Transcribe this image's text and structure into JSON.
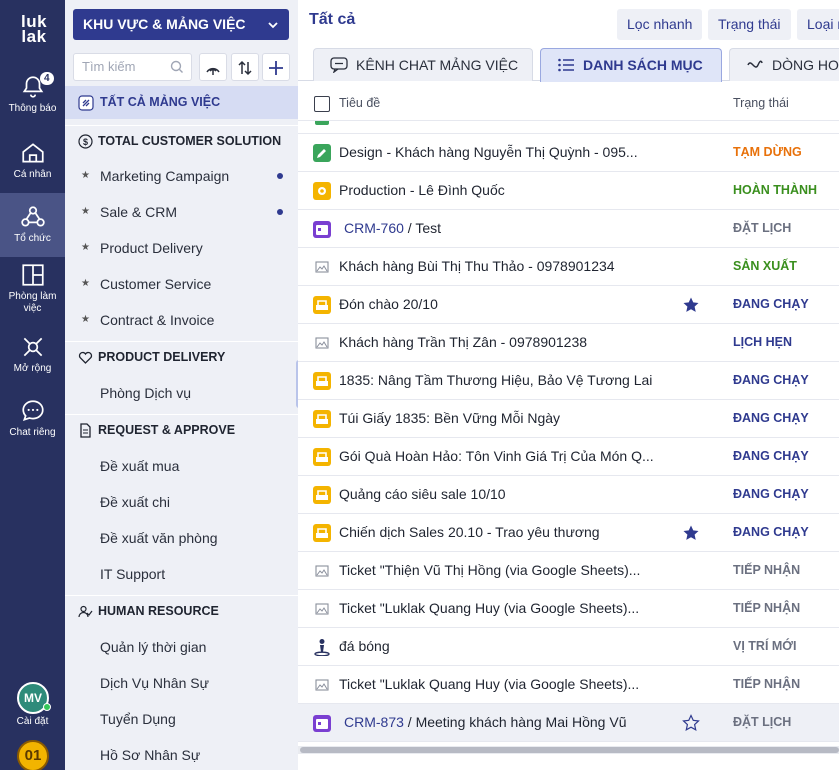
{
  "rail": {
    "logo": "luk\nlak",
    "items": [
      {
        "label": "Thông báo",
        "icon": "bell-icon",
        "badge": "4"
      },
      {
        "label": "Cá nhân",
        "icon": "home-icon"
      },
      {
        "label": "Tổ chức",
        "icon": "organization-icon"
      },
      {
        "label": "Phòng làm\nviệc",
        "icon": "workspace-icon"
      },
      {
        "label": "Mở rộng",
        "icon": "extension-icon"
      },
      {
        "label": "Chat riêng",
        "icon": "chat-icon"
      }
    ],
    "avatar_initials": "MV",
    "settings_label": "Cài đặt",
    "org_badge": "01"
  },
  "sidebar": {
    "workspace_select": "KHU VỰC & MẢNG VIỆC",
    "search_placeholder": "Tìm kiếm",
    "all_workspaces": "TẤT CẢ MẢNG VIỆC",
    "groups": [
      {
        "title": "TOTAL CUSTOMER SOLUTION",
        "icon": "dollar-icon",
        "items": [
          {
            "label": "Marketing Campaign",
            "starred": true,
            "unread": true
          },
          {
            "label": "Sale & CRM",
            "starred": true,
            "unread": true
          },
          {
            "label": "Product Delivery",
            "starred": true
          },
          {
            "label": "Customer Service",
            "starred": true
          },
          {
            "label": "Contract & Invoice",
            "starred": true
          }
        ]
      },
      {
        "title": "PRODUCT DELIVERY",
        "icon": "heart-icon",
        "items": [
          {
            "label": "Phòng Dịch vụ"
          }
        ]
      },
      {
        "title": "REQUEST & APPROVE",
        "icon": "file-icon",
        "items": [
          {
            "label": "Đề xuất mua"
          },
          {
            "label": "Đề xuất chi"
          },
          {
            "label": "Đề xuất văn phòng"
          },
          {
            "label": "IT Support"
          }
        ]
      },
      {
        "title": "HUMAN RESOURCE",
        "icon": "people-icon",
        "items": [
          {
            "label": "Quản lý thời gian"
          },
          {
            "label": "Dịch Vụ Nhân Sự"
          },
          {
            "label": "Tuyển Dụng"
          },
          {
            "label": "Hồ Sơ Nhân Sự"
          }
        ]
      }
    ]
  },
  "main": {
    "title": "Tất cả",
    "header_buttons": [
      "Lọc nhanh",
      "Trạng thái",
      "Loại m"
    ],
    "tabs": [
      {
        "label": "KÊNH CHAT MẢNG VIỆC",
        "icon": "chat-bubble-icon"
      },
      {
        "label": "DANH SÁCH MỤC",
        "icon": "list-icon",
        "active": true
      },
      {
        "label": "DÒNG HO",
        "icon": "flow-icon"
      }
    ],
    "columns": {
      "title": "Tiêu đề",
      "status": "Trạng thái"
    },
    "colors": {
      "orange": "#e8710a",
      "green": "#3a8f1e",
      "gray": "#6b7080",
      "navy": "#2f3a8f",
      "blue": "#2f3a8f"
    },
    "rows": [
      {
        "icon": "pencil-icon",
        "title": "Design - Khách hàng Nguyễn Thị Quỳnh - 095...",
        "status": "TẠM DỪNG",
        "status_color": "orange"
      },
      {
        "icon": "production-icon",
        "title": "Production - Lê Đình Quốc",
        "status": "HOÀN THÀNH",
        "status_color": "green"
      },
      {
        "icon": "calendar-icon",
        "code": "CRM-760",
        "title": " / Test",
        "status": "ĐẶT LỊCH",
        "status_color": "gray"
      },
      {
        "icon": "image-icon",
        "title": "Khách hàng Bùi Thị Thu Thảo - 0978901234",
        "status": "SẢN XUẤT",
        "status_color": "green"
      },
      {
        "icon": "campaign-icon",
        "title": "Đón chào 20/10",
        "status": "ĐANG CHẠY",
        "status_color": "navy",
        "star": "filled"
      },
      {
        "icon": "image-icon",
        "title": "Khách hàng Trần Thị Zân - 0978901238",
        "status": "LỊCH HẸN",
        "status_color": "blue"
      },
      {
        "icon": "campaign-icon",
        "title": "1835: Nâng Tầm Thương Hiệu, Bảo Vệ Tương Lai",
        "status": "ĐANG CHẠY",
        "status_color": "navy"
      },
      {
        "icon": "campaign-icon",
        "title": "Túi Giấy 1835: Bền Vững Mỗi Ngày",
        "status": "ĐANG CHẠY",
        "status_color": "navy"
      },
      {
        "icon": "campaign-icon",
        "title": "Gói Quà Hoàn Hảo: Tôn Vinh Giá Trị Của Món Q...",
        "status": "ĐANG CHẠY",
        "status_color": "navy"
      },
      {
        "icon": "campaign-icon",
        "title": "Quảng cáo siêu sale 10/10",
        "status": "ĐANG CHẠY",
        "status_color": "navy"
      },
      {
        "icon": "campaign-icon",
        "title": "Chiến dịch Sales 20.10 - Trao yêu thương",
        "status": "ĐANG CHẠY",
        "status_color": "navy",
        "star": "filled"
      },
      {
        "icon": "image-icon",
        "title": "Ticket \"Thiện Vũ Thị Hồng (via Google Sheets)...",
        "status": "TIẾP NHẬN",
        "status_color": "gray"
      },
      {
        "icon": "image-icon",
        "title": "Ticket \"Luklak Quang Huy (via Google Sheets)...",
        "status": "TIẾP NHẬN",
        "status_color": "gray"
      },
      {
        "icon": "location-icon",
        "title": "đá bóng",
        "status": "VỊ TRÍ MỚI",
        "status_color": "gray"
      },
      {
        "icon": "image-icon",
        "title": "Ticket \"Luklak Quang Huy (via Google Sheets)...",
        "status": "TIẾP NHẬN",
        "status_color": "gray"
      },
      {
        "icon": "calendar-icon",
        "code": "CRM-873",
        "title": " / Meeting khách hàng Mai Hồng Vũ",
        "status": "ĐẶT LỊCH",
        "status_color": "gray",
        "star": "outline",
        "highlight": true
      }
    ]
  }
}
